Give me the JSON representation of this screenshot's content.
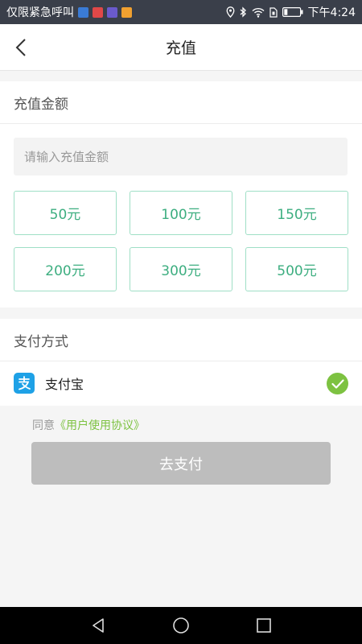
{
  "status_bar": {
    "carrier_text": "仅限紧急呼叫",
    "time": "下午4:24",
    "app_icon_colors": [
      "#3a7bd5",
      "#e04848",
      "#6a5acd",
      "#f0a030"
    ]
  },
  "header": {
    "title": "充值"
  },
  "recharge": {
    "section_title": "充值金额",
    "input_placeholder": "请输入充值金额",
    "input_value": "",
    "amounts": [
      "50元",
      "100元",
      "150元",
      "200元",
      "300元",
      "500元"
    ]
  },
  "payment": {
    "section_title": "支付方式",
    "method_label": "支付宝",
    "selected": true
  },
  "agreement": {
    "prefix": "同意",
    "link_text": "《用户使用协议》"
  },
  "submit": {
    "label": "去支付"
  },
  "colors": {
    "accent_green": "#3dae80",
    "check_green": "#7dc241",
    "alipay_blue": "#1ea1e6",
    "disabled_button": "#bdbdbd"
  }
}
